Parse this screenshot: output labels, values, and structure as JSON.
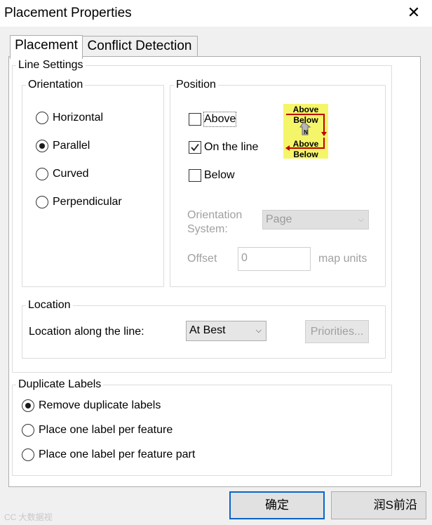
{
  "window": {
    "title": "Placement Properties",
    "close_glyph": "✕"
  },
  "tabs": [
    {
      "label": "Placement",
      "active": true
    },
    {
      "label": "Conflict Detection",
      "active": false
    }
  ],
  "line_settings": {
    "legend": "Line Settings",
    "orientation": {
      "legend": "Orientation",
      "options": [
        {
          "label": "Horizontal",
          "selected": false
        },
        {
          "label": "Parallel",
          "selected": true
        },
        {
          "label": "Curved",
          "selected": false
        },
        {
          "label": "Perpendicular",
          "selected": false
        }
      ]
    },
    "position": {
      "legend": "Position",
      "above": {
        "label": "Above",
        "checked": false
      },
      "on_the_line": {
        "label": "On the line",
        "checked": true
      },
      "below": {
        "label": "Below",
        "checked": false
      },
      "diagram": {
        "above1": "Above",
        "below1": "Below",
        "n": "N",
        "above2": "Above",
        "below2": "Below"
      },
      "orientation_system_label_1": "Orientation",
      "orientation_system_label_2": "System:",
      "orientation_system_value": "Page",
      "offset_label": "Offset",
      "offset_value": "0",
      "offset_units": "map units"
    },
    "location": {
      "legend": "Location",
      "label": "Location along the line:",
      "value": "At Best",
      "priorities_button": "Priorities..."
    }
  },
  "duplicate_labels": {
    "legend": "Duplicate Labels",
    "options": [
      {
        "label": "Remove duplicate labels",
        "selected": true
      },
      {
        "label": "Place one label per feature",
        "selected": false
      },
      {
        "label": "Place one label per feature part",
        "selected": false
      }
    ]
  },
  "footer": {
    "ok_button": "确定",
    "right_text": "润S前沿",
    "watermark_left": "CC 大数据视"
  },
  "colors": {
    "diagram_bg": "#f5f56a",
    "diagram_line": "#c00000",
    "accent": "#0a64c8"
  }
}
